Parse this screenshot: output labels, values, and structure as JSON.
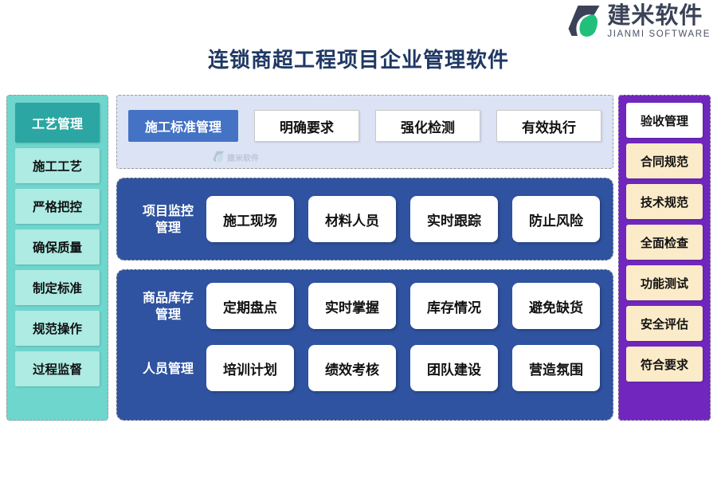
{
  "brand": {
    "logo_icon": "jianmi-leaf-logo-icon",
    "name_cn": "建米软件",
    "name_en": "JIANMI SOFTWARE",
    "logo_dark": "#3B4257",
    "logo_green": "#21C07A"
  },
  "header": {
    "title": "连锁商超工程项目企业管理软件",
    "title_color": "#1F3864"
  },
  "left_rail": {
    "bg_color": "#6FD6CE",
    "head_color": "#2BA6A2",
    "item_color": "#ADEBE3",
    "head": "工艺管理",
    "items": [
      {
        "label": "施工工艺"
      },
      {
        "label": "严格把控"
      },
      {
        "label": "确保质量"
      },
      {
        "label": "制定标准"
      },
      {
        "label": "规范操作"
      },
      {
        "label": "过程监督"
      }
    ]
  },
  "right_rail": {
    "bg_color": "#7127BE",
    "head_color": "#FFFFFF",
    "item_color": "#FCEBC8",
    "head": "验收管理",
    "items": [
      {
        "label": "合同规范"
      },
      {
        "label": "技术规范"
      },
      {
        "label": "全面检查"
      },
      {
        "label": "功能测试"
      },
      {
        "label": "安全评估"
      },
      {
        "label": "符合要求"
      }
    ]
  },
  "panels": {
    "standards": {
      "bg_color": "#DCE3F5",
      "chip_color": "#4472C4",
      "chip_label": "施工标准管理",
      "cards": [
        {
          "label": "明确要求"
        },
        {
          "label": "强化检测"
        },
        {
          "label": "有效执行"
        }
      ],
      "watermark_cn": "建米软件"
    },
    "monitoring": {
      "bg_color": "#2F53A0",
      "row_label": "项目监控\n管理",
      "row_label_line1": "项目监控",
      "row_label_line2": "管理",
      "cards": [
        {
          "label": "施工现场"
        },
        {
          "label": "材料人员"
        },
        {
          "label": "实时跟踪"
        },
        {
          "label": "防止风险"
        }
      ]
    },
    "inventory_staff": {
      "bg_color": "#2F53A0",
      "rows": [
        {
          "label_line1": "商品库存",
          "label_line2": "管理",
          "cards": [
            {
              "label": "定期盘点"
            },
            {
              "label": "实时掌握"
            },
            {
              "label": "库存情况"
            },
            {
              "label": "避免缺货"
            }
          ]
        },
        {
          "label_line1": "人员管理",
          "label_line2": "",
          "cards": [
            {
              "label": "培训计划"
            },
            {
              "label": "绩效考核"
            },
            {
              "label": "团队建设"
            },
            {
              "label": "营造氛围"
            }
          ]
        }
      ]
    }
  }
}
